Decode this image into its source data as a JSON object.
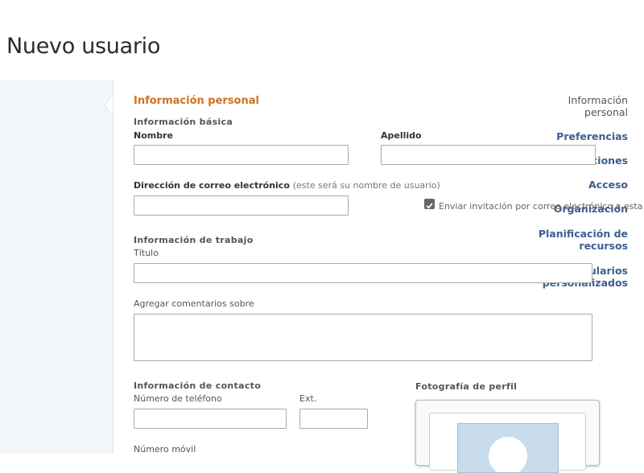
{
  "page": {
    "title": "Nuevo usuario"
  },
  "sidebar": {
    "items": [
      {
        "label_lines": [
          "Información",
          "personal"
        ],
        "active": true
      },
      {
        "label_lines": [
          "Preferencias"
        ]
      },
      {
        "label_lines": [
          "Notificaciones"
        ]
      },
      {
        "label_lines": [
          "Acceso"
        ]
      },
      {
        "label_lines": [
          "Organización"
        ]
      },
      {
        "label_lines": [
          "Planificación de",
          "recursos"
        ]
      },
      {
        "label_lines": [
          "Formularios",
          "personalizados"
        ]
      }
    ]
  },
  "form": {
    "section_title": "Información personal",
    "basic": {
      "title": "Información básica",
      "first_name_label": "Nombre",
      "first_name_value": "",
      "last_name_label": "Apellido",
      "last_name_value": "",
      "email_label": "Dirección de correo electrónico",
      "email_hint": "(este será su nombre de usuario)",
      "email_value": "",
      "invite_checked": true,
      "invite_label": "Enviar invitación por correo electrónico a esta pe"
    },
    "work": {
      "title": "Información de trabajo",
      "job_title_label": "Título",
      "job_title_value": "",
      "comments_label": "Agregar comentarios sobre",
      "comments_value": ""
    },
    "contact": {
      "title": "Información de contacto",
      "phone_label": "Número de teléfono",
      "phone_value": "",
      "ext_label": "Ext.",
      "ext_value": "",
      "mobile_label": "Número móvil"
    },
    "photo": {
      "title": "Fotografía de perfil"
    }
  },
  "colors": {
    "section_accent": "#d0731a",
    "nav_link": "#3b5f8f",
    "sidebar_bg": "#f3f6fa",
    "avatar_bg": "#c9dceb"
  }
}
